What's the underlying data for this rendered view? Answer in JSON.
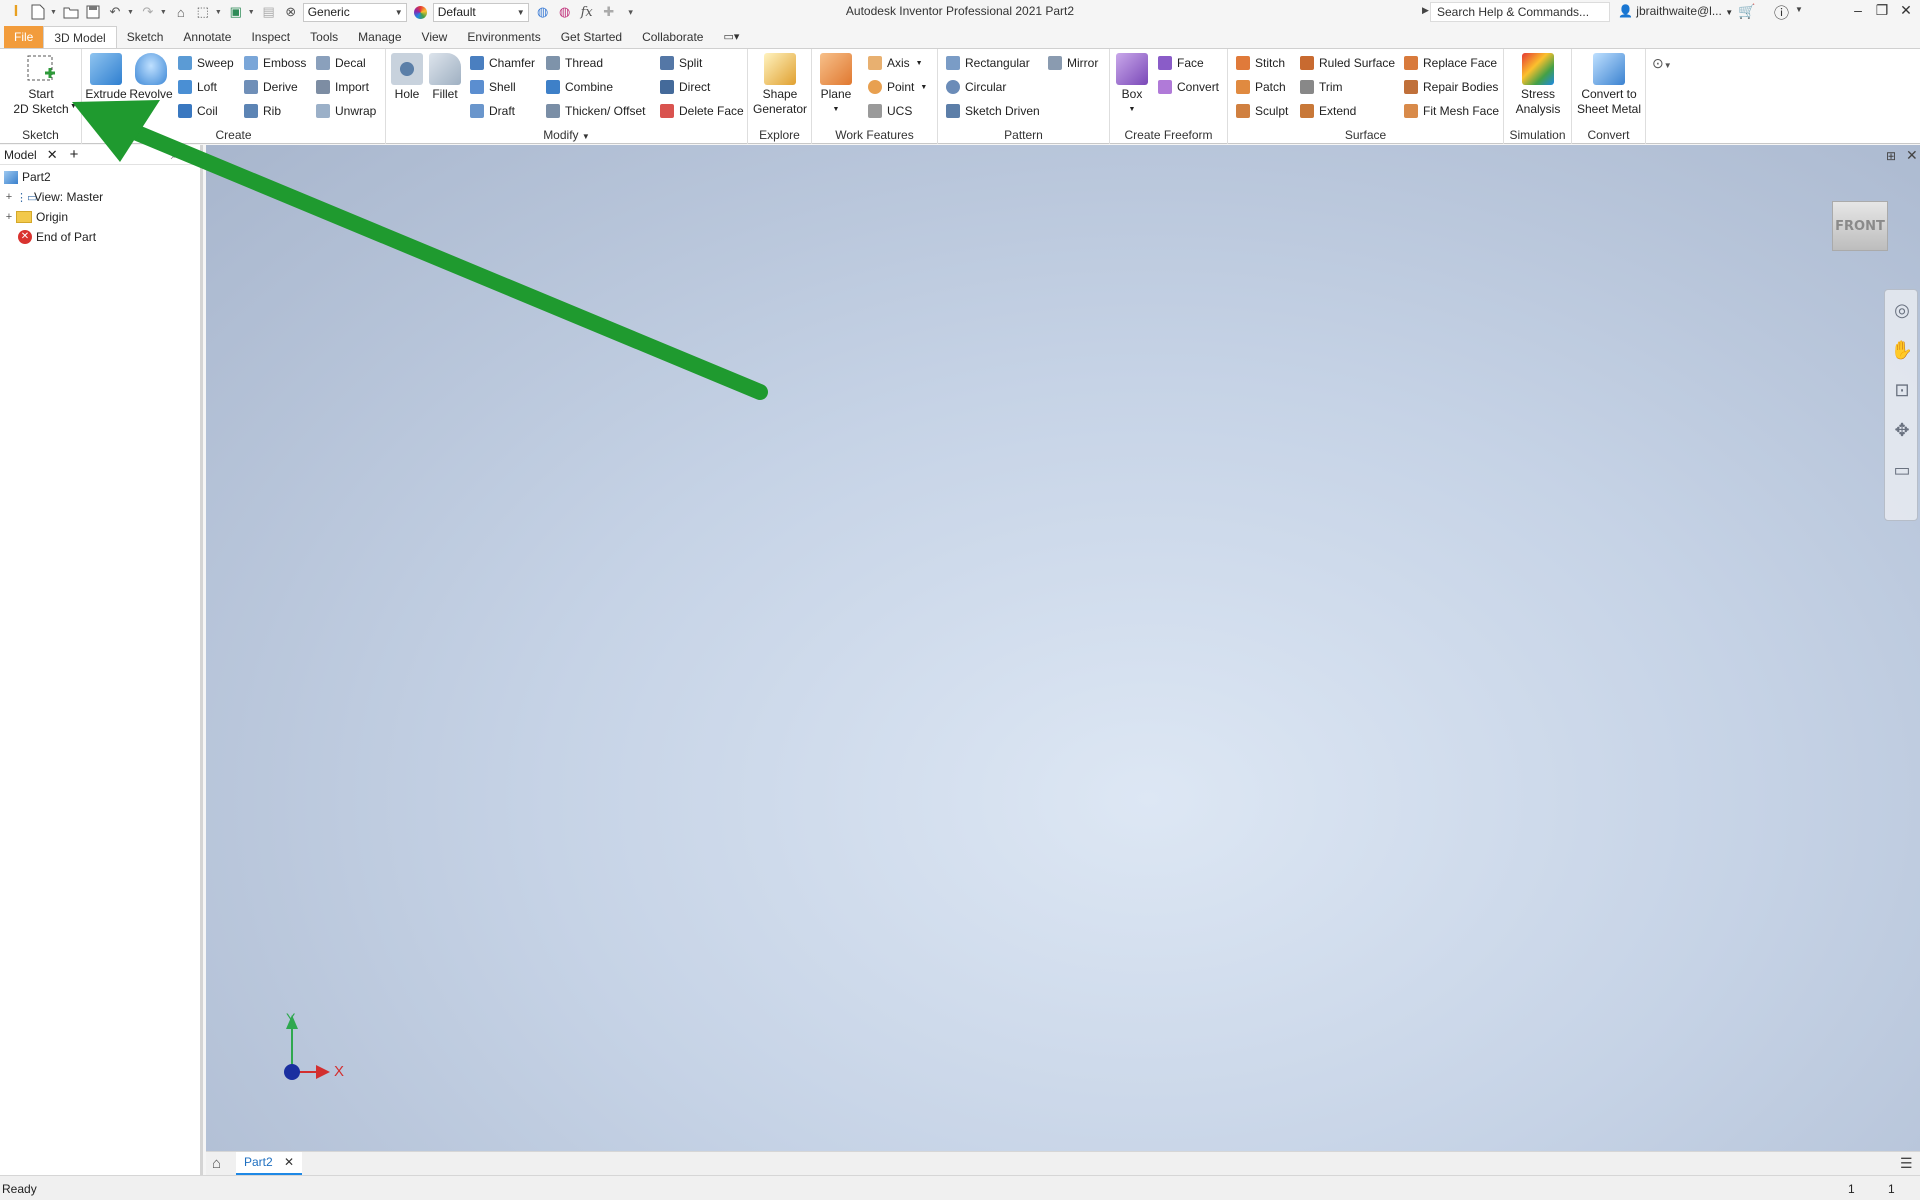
{
  "titlebar": {
    "app_title": "Autodesk Inventor Professional 2021   Part2",
    "material_combo": "Generic",
    "appearance_combo": "Default",
    "search_placeholder": "Search Help & Commands...",
    "user": "jbraithwaite@l...",
    "fx": "fx"
  },
  "tabs": [
    "File",
    "3D Model",
    "Sketch",
    "Annotate",
    "Inspect",
    "Tools",
    "Manage",
    "View",
    "Environments",
    "Get Started",
    "Collaborate"
  ],
  "ribbon": {
    "sketch": {
      "title": "Sketch",
      "start_label_1": "Start",
      "start_label_2": "2D Sketch"
    },
    "create": {
      "title": "Create",
      "extrude": "Extrude",
      "revolve": "Revolve",
      "sweep": "Sweep",
      "emboss": "Emboss",
      "decal": "Decal",
      "loft": "Loft",
      "derive": "Derive",
      "import": "Import",
      "coil": "Coil",
      "rib": "Rib",
      "unwrap": "Unwrap"
    },
    "modify": {
      "title": "Modify",
      "hole": "Hole",
      "fillet": "Fillet",
      "chamfer": "Chamfer",
      "thread": "Thread",
      "split": "Split",
      "shell": "Shell",
      "combine": "Combine",
      "direct": "Direct",
      "draft": "Draft",
      "thicken": "Thicken/ Offset",
      "delete_face": "Delete Face"
    },
    "explore": {
      "title": "Explore",
      "shape_1": "Shape",
      "shape_2": "Generator"
    },
    "work": {
      "title": "Work Features",
      "plane": "Plane",
      "axis": "Axis",
      "point": "Point",
      "ucs": "UCS"
    },
    "pattern": {
      "title": "Pattern",
      "rectangular": "Rectangular",
      "mirror": "Mirror",
      "circular": "Circular",
      "sketch_driven": "Sketch Driven"
    },
    "freeform": {
      "title": "Create Freeform",
      "box": "Box",
      "face": "Face",
      "convert": "Convert"
    },
    "surface": {
      "title": "Surface",
      "stitch": "Stitch",
      "ruled": "Ruled Surface",
      "replace_face": "Replace Face",
      "patch": "Patch",
      "trim": "Trim",
      "repair": "Repair Bodies",
      "sculpt": "Sculpt",
      "extend": "Extend",
      "fit_mesh": "Fit Mesh Face"
    },
    "simulation": {
      "title": "Simulation",
      "stress_1": "Stress",
      "stress_2": "Analysis"
    },
    "convert": {
      "title": "Convert",
      "sm_1": "Convert to",
      "sm_2": "Sheet Metal"
    }
  },
  "browser": {
    "tab": "Model",
    "items": [
      {
        "label": "Part2"
      },
      {
        "label": "View: Master"
      },
      {
        "label": "Origin"
      },
      {
        "label": "End of Part"
      }
    ]
  },
  "viewport": {
    "viewcube": "FRONT",
    "triad_x": "X",
    "triad_y": "Y"
  },
  "doctabs": {
    "tab": "Part2"
  },
  "status": {
    "text": "Ready",
    "count_1": "1",
    "count_2": "1"
  },
  "colors": {
    "file_tab": "#f29c3c",
    "annotation_arrow": "#1f9a2f",
    "axis_x": "#d32f2f",
    "axis_y": "#2fa84f",
    "origin": "#1a2fa0"
  }
}
